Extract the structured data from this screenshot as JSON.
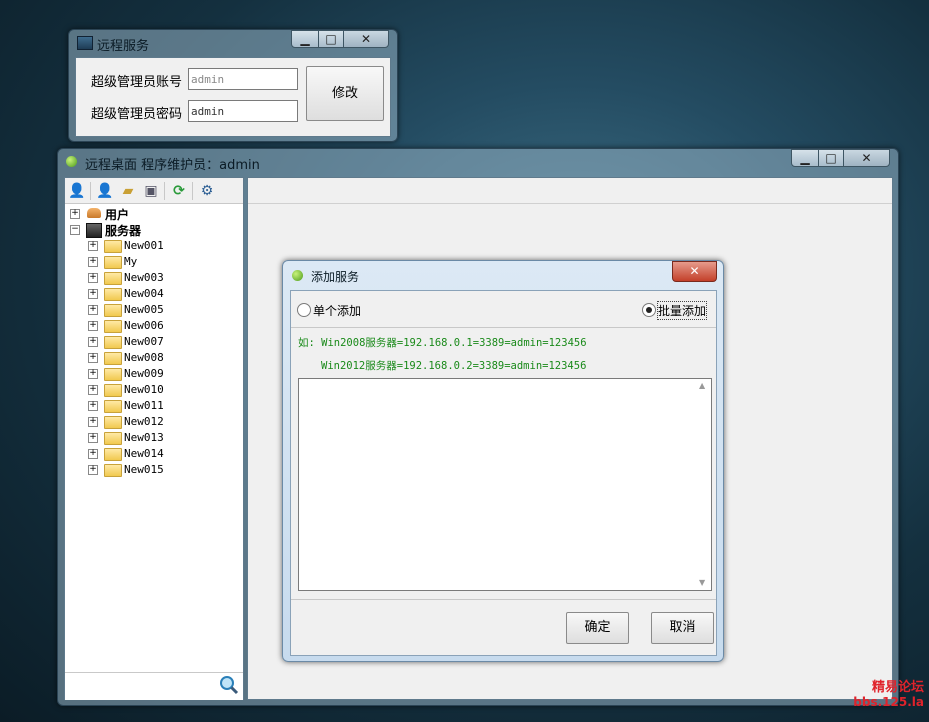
{
  "small_window": {
    "title": "远程服务",
    "min": "▁",
    "max": "□",
    "close": "✕",
    "account_label": "超级管理员账号",
    "account_value": "admin",
    "password_label": "超级管理员密码",
    "password_value": "admin",
    "modify_button": "修改"
  },
  "main_window": {
    "title": "远程桌面   程序维护员：admin",
    "min": "▁",
    "max": "□",
    "close": "✕",
    "toolbar_icons": [
      "user-icon",
      "add-user-icon",
      "add-folder-icon",
      "add-server-icon",
      "refresh-icon",
      "settings-icon"
    ],
    "tree": {
      "users_label": "用户",
      "servers_label": "服务器",
      "servers": [
        "New001",
        "My",
        "New003",
        "New004",
        "New005",
        "New006",
        "New007",
        "New008",
        "New009",
        "New010",
        "New011",
        "New012",
        "New013",
        "New014",
        "New015"
      ]
    }
  },
  "dialog": {
    "title": "添加服务",
    "close": "✕",
    "single_add": "单个添加",
    "batch_add": "批量添加",
    "selected_mode": "batch",
    "example_line1": "如: Win2008服务器=192.168.0.1=3389=admin=123456",
    "example_line2": "Win2012服务器=192.168.0.2=3389=admin=123456",
    "textarea_value": "",
    "ok_button": "确定",
    "cancel_button": "取消"
  },
  "watermark": {
    "line1": "精易论坛",
    "line2": "bbs.125.la"
  },
  "colors": {
    "example_text": "#1a8a1a",
    "watermark_red": "#e0232b"
  }
}
